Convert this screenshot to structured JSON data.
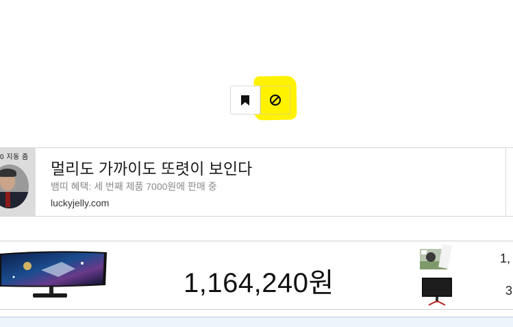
{
  "toolbar": {
    "bookmark_icon": "bookmark-icon",
    "block_icon": "block-icon",
    "highlight_color": "#fff200"
  },
  "ad": {
    "thumb_label": "0 지동 줌",
    "title": "멀리도 가까이도 또렷이 보인다",
    "description": "뱀띠 혜택: 세 번째 제품 7000원에 판매 중",
    "domain": "luckyjelly.com"
  },
  "product": {
    "price": "1,164,240원",
    "side_value_1": "1,",
    "side_value_2": "3"
  }
}
